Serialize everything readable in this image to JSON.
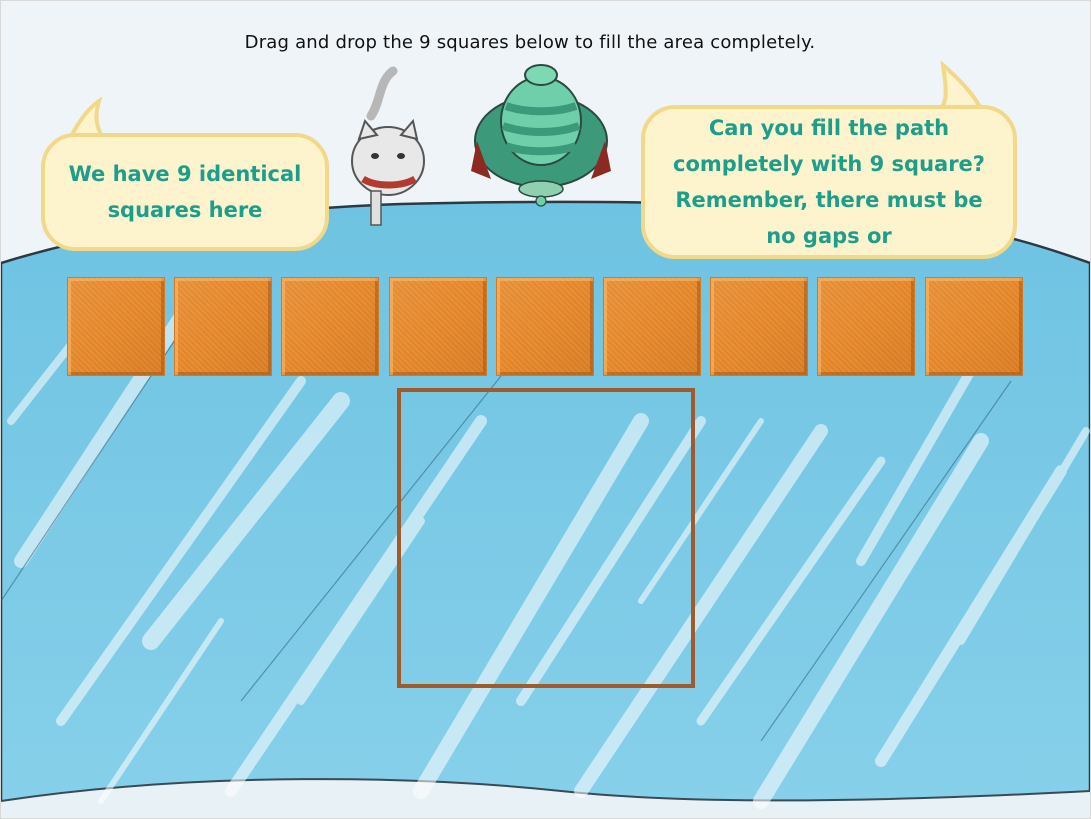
{
  "instruction": "Drag and drop the 9 squares below to fill the area completely.",
  "bubbles": {
    "left": "We have 9 identical squares here",
    "right": "Can you fill the path completely with 9 square? Remember, there must be no gaps or"
  },
  "tiles": {
    "count": 9,
    "color": "#e8892b"
  },
  "drop_area": {
    "border_color": "#a05a2c"
  },
  "colors": {
    "bubble_text": "#1c9e8c",
    "bubble_fill": "#fdf3cd",
    "bubble_border": "#f2d889",
    "ice": "#7ccbe6"
  },
  "characters": [
    "cat-character",
    "turtle-character"
  ]
}
